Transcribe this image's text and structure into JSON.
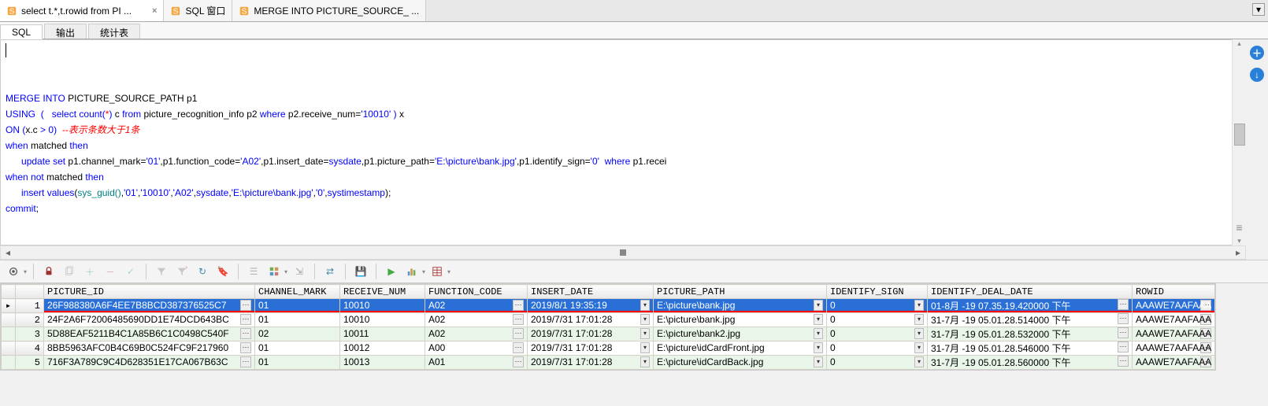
{
  "file_tabs": [
    {
      "label": "select t.*,t.rowid from PI ...",
      "active": true
    },
    {
      "label": "SQL 窗口",
      "active": false
    },
    {
      "label": "MERGE INTO PICTURE_SOURCE_ ...",
      "active": false
    }
  ],
  "sub_tabs": [
    {
      "label": "SQL",
      "active": true
    },
    {
      "label": "输出",
      "active": false
    },
    {
      "label": "统计表",
      "active": false
    }
  ],
  "sql_tokens": [
    [
      {
        "t": "MERGE",
        "c": "kw-blue"
      },
      {
        "t": " "
      },
      {
        "t": "INTO",
        "c": "kw-blue"
      },
      {
        "t": " PICTURE_SOURCE_PATH p1"
      }
    ],
    [
      {
        "t": "USING",
        "c": "kw-blue"
      },
      {
        "t": "  "
      },
      {
        "t": "(",
        "c": "kw-op"
      },
      {
        "t": "   "
      },
      {
        "t": "select",
        "c": "kw-blue"
      },
      {
        "t": " "
      },
      {
        "t": "count",
        "c": "kw-blue"
      },
      {
        "t": "(",
        "c": "kw-op"
      },
      {
        "t": "*",
        "c": "kw-red"
      },
      {
        "t": ")",
        "c": "kw-op"
      },
      {
        "t": " c "
      },
      {
        "t": "from",
        "c": "kw-blue"
      },
      {
        "t": " picture_recognition_info p2 "
      },
      {
        "t": "where",
        "c": "kw-blue"
      },
      {
        "t": " p2.receive_num="
      },
      {
        "t": "'10010'",
        "c": "kw-str"
      },
      {
        "t": " "
      },
      {
        "t": ")",
        "c": "kw-op"
      },
      {
        "t": " x"
      }
    ],
    [
      {
        "t": "ON",
        "c": "kw-blue"
      },
      {
        "t": " "
      },
      {
        "t": "(",
        "c": "kw-op"
      },
      {
        "t": "x.c "
      },
      {
        "t": ">",
        "c": "kw-op"
      },
      {
        "t": " "
      },
      {
        "t": "0",
        "c": "kw-op"
      },
      {
        "t": ")",
        "c": "kw-op"
      },
      {
        "t": "  "
      },
      {
        "t": "--表示条数大于1条",
        "c": "comment-red"
      }
    ],
    [
      {
        "t": "when",
        "c": "kw-blue"
      },
      {
        "t": " matched "
      },
      {
        "t": "then",
        "c": "kw-blue"
      }
    ],
    [
      {
        "t": "      "
      },
      {
        "t": "update",
        "c": "kw-blue"
      },
      {
        "t": " "
      },
      {
        "t": "set",
        "c": "kw-blue"
      },
      {
        "t": " p1.channel_mark="
      },
      {
        "t": "'01'",
        "c": "kw-str"
      },
      {
        "t": ",p1.function_code="
      },
      {
        "t": "'A02'",
        "c": "kw-str"
      },
      {
        "t": ",p1.insert_date="
      },
      {
        "t": "sysdate",
        "c": "kw-blue"
      },
      {
        "t": ",p1.picture_path="
      },
      {
        "t": "'E:\\picture\\bank.jpg'",
        "c": "kw-str"
      },
      {
        "t": ",p1.identify_sign="
      },
      {
        "t": "'0'",
        "c": "kw-str"
      },
      {
        "t": "  "
      },
      {
        "t": "where",
        "c": "kw-blue"
      },
      {
        "t": " p1.recei"
      }
    ],
    [
      {
        "t": "when",
        "c": "kw-blue"
      },
      {
        "t": " "
      },
      {
        "t": "not",
        "c": "kw-blue"
      },
      {
        "t": " matched "
      },
      {
        "t": "then",
        "c": "kw-blue"
      }
    ],
    [
      {
        "t": "      "
      },
      {
        "t": "insert",
        "c": "kw-blue"
      },
      {
        "t": " "
      },
      {
        "t": "values",
        "c": "kw-blue"
      },
      {
        "t": "("
      },
      {
        "t": "sys_guid()",
        "c": "kw-teal"
      },
      {
        "t": ","
      },
      {
        "t": "'01'",
        "c": "kw-str"
      },
      {
        "t": ","
      },
      {
        "t": "'10010'",
        "c": "kw-str"
      },
      {
        "t": ","
      },
      {
        "t": "'A02'",
        "c": "kw-str"
      },
      {
        "t": ","
      },
      {
        "t": "sysdate",
        "c": "kw-blue"
      },
      {
        "t": ","
      },
      {
        "t": "'E:\\picture\\bank.jpg'",
        "c": "kw-str"
      },
      {
        "t": ","
      },
      {
        "t": "'0'",
        "c": "kw-str"
      },
      {
        "t": ","
      },
      {
        "t": "systimestamp",
        "c": "kw-blue"
      },
      {
        "t": ");"
      }
    ],
    [
      {
        "t": "commit",
        "c": "kw-blue"
      },
      {
        "t": ";"
      }
    ]
  ],
  "grid": {
    "columns": [
      "PICTURE_ID",
      "CHANNEL_MARK",
      "RECEIVE_NUM",
      "FUNCTION_CODE",
      "INSERT_DATE",
      "PICTURE_PATH",
      "IDENTIFY_SIGN",
      "IDENTIFY_DEAL_DATE",
      "ROWID"
    ],
    "rows": [
      {
        "n": "1",
        "sel": true,
        "ptr": "▸",
        "cells": [
          "26F988380A6F4EE7B8BCD387376525C7",
          "01",
          "10010",
          "A02",
          "2019/8/1 19:35:19",
          "E:\\picture\\bank.jpg",
          "0",
          "01-8月 -19 07.35.19.420000 下午",
          "AAAWE7AAFAAA"
        ]
      },
      {
        "n": "2",
        "cells": [
          "24F2A6F72006485690DD1E74DCD643BC",
          "01",
          "10010",
          "A02",
          "2019/7/31 17:01:28",
          "E:\\picture\\bank.jpg",
          "0",
          "31-7月 -19 05.01.28.514000 下午",
          "AAAWE7AAFAAA"
        ]
      },
      {
        "n": "3",
        "alt": true,
        "cells": [
          "5D88EAF5211B4C1A85B6C1C0498C540F",
          "02",
          "10011",
          "A02",
          "2019/7/31 17:01:28",
          "E:\\picture\\bank2.jpg",
          "0",
          "31-7月 -19 05.01.28.532000 下午",
          "AAAWE7AAFAAA"
        ]
      },
      {
        "n": "4",
        "cells": [
          "8BB5963AFC0B4C69B0C524FC9F217960",
          "01",
          "10012",
          "A00",
          "2019/7/31 17:01:28",
          "E:\\picture\\idCardFront.jpg",
          "0",
          "31-7月 -19 05.01.28.546000 下午",
          "AAAWE7AAFAAA"
        ]
      },
      {
        "n": "5",
        "alt": true,
        "cells": [
          "716F3A789C9C4D628351E17CA067B63C",
          "01",
          "10013",
          "A01",
          "2019/7/31 17:01:28",
          "E:\\picture\\idCardBack.jpg",
          "0",
          "31-7月 -19 05.01.28.560000 下午",
          "AAAWE7AAFAAA"
        ]
      }
    ]
  },
  "icons": {
    "ellipsis": "⋯",
    "dd": "▾",
    "close": "×",
    "left": "◂",
    "right": "▸",
    "plus": "＋",
    "down": "↓"
  }
}
